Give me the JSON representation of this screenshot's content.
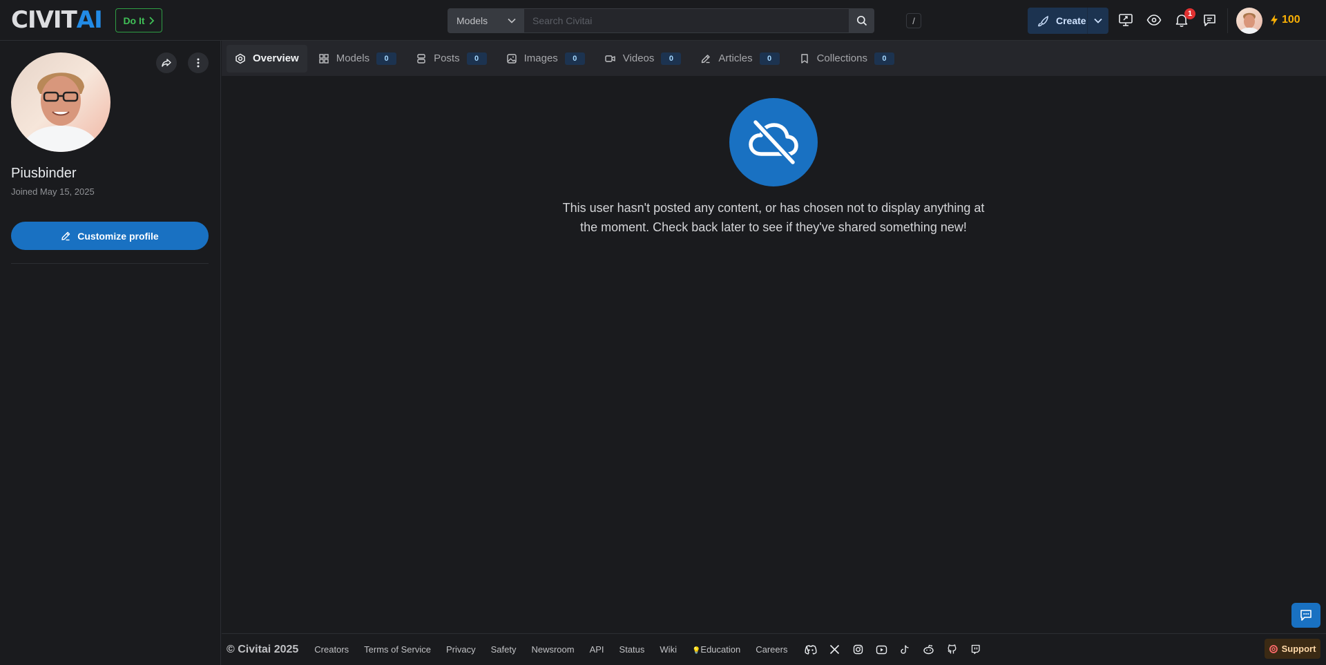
{
  "header": {
    "logo_text_a": "CIVIT",
    "logo_text_b": "AI",
    "doit_label": "Do It",
    "search_category": "Models",
    "search_placeholder": "Search Civitai",
    "search_shortcut": "/",
    "create_label": "Create",
    "notification_count": "1",
    "buzz_amount": "100"
  },
  "profile": {
    "username": "Piusbinder",
    "joined": "Joined May 15, 2025",
    "customize_label": "Customize profile"
  },
  "tabs": [
    {
      "label": "Overview",
      "icon": "overview-icon"
    },
    {
      "label": "Models",
      "count": "0",
      "icon": "grid-icon"
    },
    {
      "label": "Posts",
      "count": "0",
      "icon": "posts-icon"
    },
    {
      "label": "Images",
      "count": "0",
      "icon": "image-icon"
    },
    {
      "label": "Videos",
      "count": "0",
      "icon": "video-icon"
    },
    {
      "label": "Articles",
      "count": "0",
      "icon": "pencil-icon"
    },
    {
      "label": "Collections",
      "count": "0",
      "icon": "bookmark-icon"
    }
  ],
  "empty_state": {
    "icon": "cloud-off-icon",
    "message": "This user hasn't posted any content, or has chosen not to display anything at the moment. Check back later to see if they've shared something new!"
  },
  "footer": {
    "copyright": "© Civitai 2025",
    "links": [
      "Creators",
      "Terms of Service",
      "Privacy",
      "Safety",
      "Newsroom",
      "API",
      "Status",
      "Wiki",
      "Education",
      "Careers"
    ],
    "education_emoji": "💡",
    "support_label": "Support"
  },
  "colors": {
    "background": "#1a1b1e",
    "accent_blue": "#1971c2",
    "buzz_yellow": "#fab005",
    "doit_green": "#40c057",
    "badge_red": "#e03131"
  }
}
